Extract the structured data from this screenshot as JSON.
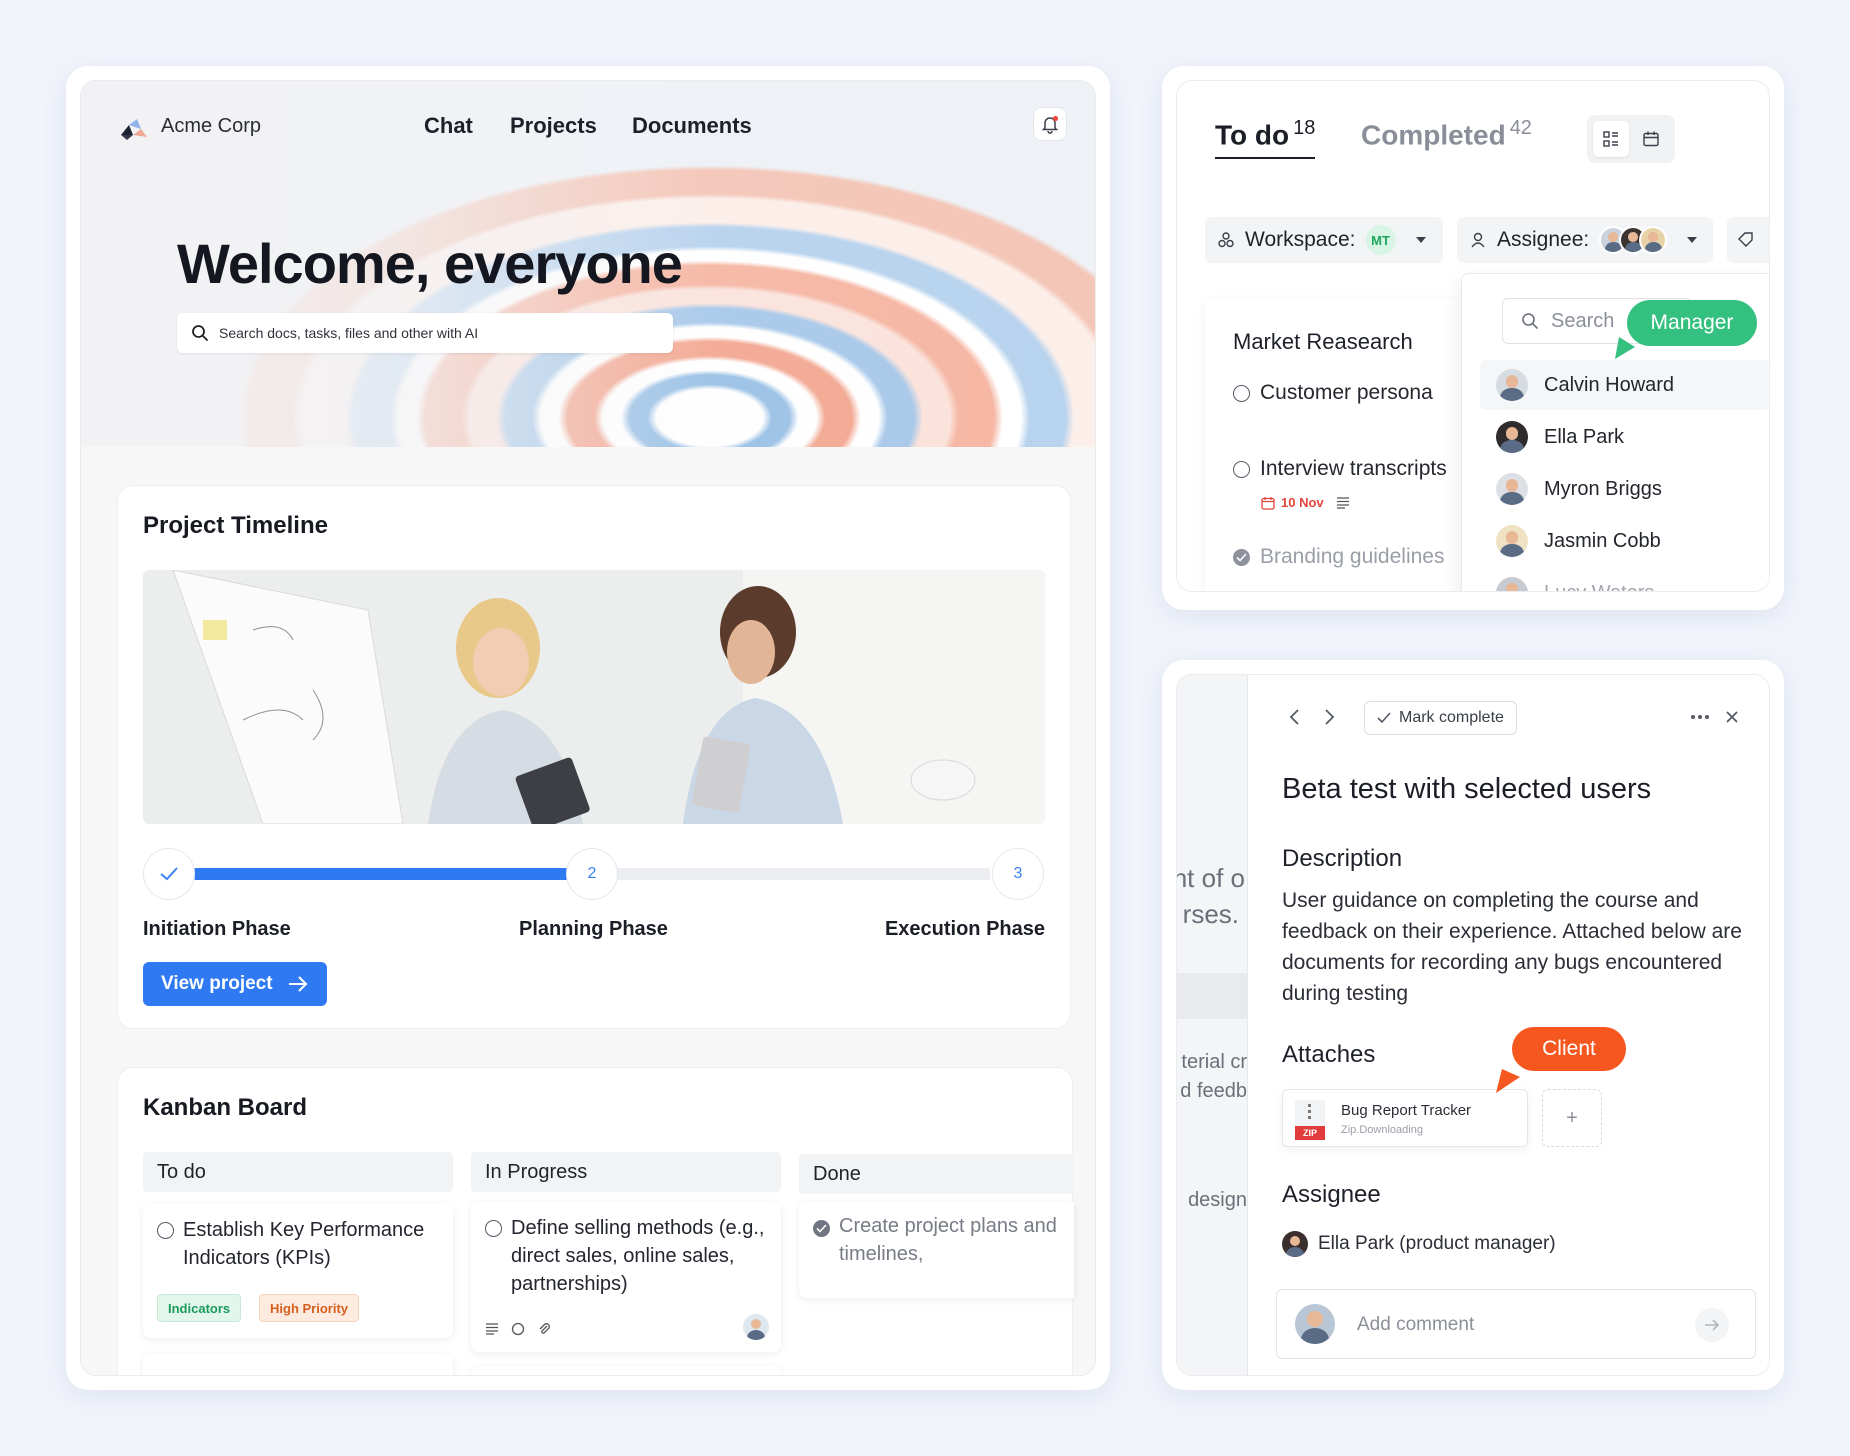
{
  "colors": {
    "primary": "#2f7af2",
    "manager_pill": "#34c07f",
    "client_pill": "#f6571f",
    "tag_indicators_bg": "#e3f6ec",
    "tag_indicators_fg": "#1a9b5c",
    "tag_priority_bg": "#fdebe0",
    "tag_priority_fg": "#d65f1e",
    "date_red": "#e2453c"
  },
  "header": {
    "brand": "Acme Corp",
    "nav": [
      "Chat",
      "Projects",
      "Documents"
    ],
    "title": "Welcome, everyone",
    "search_placeholder": "Search docs, tasks, files and other with AI"
  },
  "timeline": {
    "title": "Project Timeline",
    "progress": 0.5,
    "steps": [
      {
        "label": "Initiation Phase",
        "marker": "check"
      },
      {
        "label": "Planning Phase",
        "marker": "2"
      },
      {
        "label": "Execution Phase",
        "marker": "3"
      }
    ],
    "button": "View project"
  },
  "kanban": {
    "title": "Kanban Board",
    "columns": [
      {
        "name": "To do",
        "card": "Establish Key Performance Indicators (KPIs)",
        "tags": [
          "Indicators",
          "High Priority"
        ]
      },
      {
        "name": "In Progress",
        "card": "Define selling methods (e.g., direct sales, online sales, partnerships)"
      },
      {
        "name": "Done",
        "card": "Create project plans and timelines,"
      }
    ]
  },
  "tasks": {
    "tab_todo": "To do",
    "todo_count": "18",
    "tab_completed": "Completed",
    "completed_count": "42",
    "filter_workspace": "Workspace:",
    "workspace_badge": "MT",
    "filter_assignee": "Assignee:",
    "group_title": "Market Reasearch",
    "items": [
      {
        "label": "Customer persona",
        "done": false
      },
      {
        "label": "Interview transcripts",
        "done": false,
        "date": "10 Nov"
      },
      {
        "label": "Branding guidelines",
        "done": true
      }
    ],
    "dropdown": {
      "search_placeholder": "Search",
      "people": [
        "Calvin Howard",
        "Ella Park",
        "Myron Briggs",
        "Jasmin Cobb",
        "Lucy Waters"
      ]
    },
    "manager_label": "Manager"
  },
  "detail": {
    "mark_complete": "Mark complete",
    "title": "Beta test with selected users",
    "description_heading": "Description",
    "description": "User guidance on completing the course and feedback on their experience. Attached below are documents for recording any bugs encountered during testing",
    "attaches_heading": "Attaches",
    "file_name": "Bug Report Tracker",
    "file_status": "Zip.Downloading",
    "file_badge": "ZIP",
    "client_label": "Client",
    "assignee_heading": "Assignee",
    "assignee": "Ella Park (product manager)",
    "comment_placeholder": "Add comment",
    "background_fragments": [
      "nt of o",
      "rses.",
      "terial cr",
      "d feedb",
      "design"
    ]
  }
}
